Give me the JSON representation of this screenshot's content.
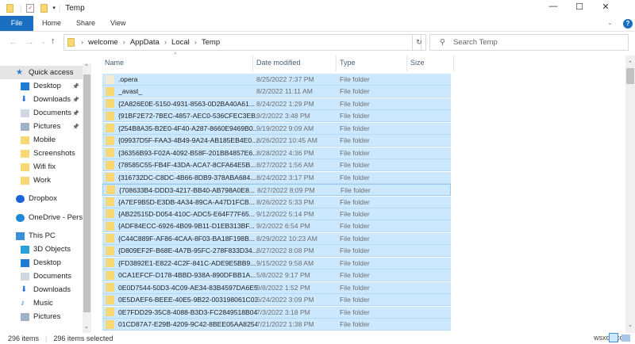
{
  "window": {
    "title": "Temp",
    "minimize": "—",
    "maximize": "☐",
    "close": "✕",
    "help": "?"
  },
  "ribbon": {
    "tabs": [
      "File",
      "Home",
      "Share",
      "View"
    ]
  },
  "address": {
    "crumbs": [
      "welcome",
      "AppData",
      "Local",
      "Temp"
    ],
    "search_placeholder": "Search Temp"
  },
  "nav": {
    "items": [
      {
        "label": "Quick access",
        "icon": "star-icon",
        "color": "#2b78d8",
        "indent": 0,
        "pinned": false
      },
      {
        "label": "Desktop",
        "icon": "desktop-icon",
        "color": "#1e7bd6",
        "indent": 1,
        "pinned": true
      },
      {
        "label": "Downloads",
        "icon": "download-icon",
        "color": "#2b78d8",
        "indent": 1,
        "pinned": true
      },
      {
        "label": "Documents",
        "icon": "document-icon",
        "color": "#cfd8e3",
        "indent": 1,
        "pinned": true
      },
      {
        "label": "Pictures",
        "icon": "pictures-icon",
        "color": "#9fb3c8",
        "indent": 1,
        "pinned": true
      },
      {
        "label": "Mobile",
        "icon": "folder-icon",
        "color": "#f8d775",
        "indent": 1,
        "pinned": false
      },
      {
        "label": "Screenshots",
        "icon": "folder-icon",
        "color": "#f8d775",
        "indent": 1,
        "pinned": false
      },
      {
        "label": "Wifi fix",
        "icon": "folder-icon",
        "color": "#f8d775",
        "indent": 1,
        "pinned": false
      },
      {
        "label": "Work",
        "icon": "folder-icon",
        "color": "#f8d775",
        "indent": 1,
        "pinned": false
      },
      {
        "label": "Dropbox",
        "icon": "dropbox-icon",
        "color": "#1d63d8",
        "indent": 0,
        "pinned": false
      },
      {
        "label": "OneDrive - Person",
        "icon": "onedrive-icon",
        "color": "#1e88d6",
        "indent": 0,
        "pinned": false
      },
      {
        "label": "This PC",
        "icon": "pc-icon",
        "color": "#3b8fd8",
        "indent": 0,
        "pinned": false
      },
      {
        "label": "3D Objects",
        "icon": "3d-objects-icon",
        "color": "#2aa0d8",
        "indent": 1,
        "pinned": false
      },
      {
        "label": "Desktop",
        "icon": "desktop-icon",
        "color": "#1e7bd6",
        "indent": 1,
        "pinned": false
      },
      {
        "label": "Documents",
        "icon": "document-icon",
        "color": "#cfd8e3",
        "indent": 1,
        "pinned": false
      },
      {
        "label": "Downloads",
        "icon": "download-icon",
        "color": "#2b78d8",
        "indent": 1,
        "pinned": false
      },
      {
        "label": "Music",
        "icon": "music-icon",
        "color": "#1e7bd6",
        "indent": 1,
        "pinned": false
      },
      {
        "label": "Pictures",
        "icon": "pictures-icon",
        "color": "#9fb3c8",
        "indent": 1,
        "pinned": false
      }
    ]
  },
  "columns": [
    "Name",
    "Date modified",
    "Type",
    "Size"
  ],
  "files": [
    {
      "name": ".opera",
      "date": "8/25/2022 7:37 PM",
      "type": "File folder"
    },
    {
      "name": "_avast_",
      "date": "8/2/2022 11:11 AM",
      "type": "File folder"
    },
    {
      "name": "{2A826E0E-5150-4931-8563-0D2BA40A61...",
      "date": "8/24/2022 1:29 PM",
      "type": "File folder"
    },
    {
      "name": "{91BF2E72-7BEC-4857-AEC0-536CFEC3EB...",
      "date": "9/2/2022 3:48 PM",
      "type": "File folder"
    },
    {
      "name": "{254B8A35-B2E0-4F40-A287-8660E9469B0...",
      "date": "9/19/2022 9:09 AM",
      "type": "File folder"
    },
    {
      "name": "{09937D5F-FAA3-4B49-9A24-AB185EB4E0...",
      "date": "8/26/2022 10:45 AM",
      "type": "File folder"
    },
    {
      "name": "{36356B93-F02A-4092-B58F-201BB4857E6...",
      "date": "8/28/2022 4:36 PM",
      "type": "File folder"
    },
    {
      "name": "{78585C55-FB4F-43DA-ACA7-8CFA64E5B...",
      "date": "8/27/2022 1:56 AM",
      "type": "File folder"
    },
    {
      "name": "{316732DC-C8DC-4B66-8DB9-378ABA684...",
      "date": "8/24/2022 3:17 PM",
      "type": "File folder"
    },
    {
      "name": "{708633B4-DDD3-4217-BB40-AB798A0E8...",
      "date": "8/27/2022 8:09 PM",
      "type": "File folder"
    },
    {
      "name": "{A7EF9B5D-E3DB-4A34-89CA-A47D1FCB...",
      "date": "8/26/2022 5:33 PM",
      "type": "File folder"
    },
    {
      "name": "{AB22515D-D054-410C-ADC5-E64F77F65...",
      "date": "9/12/2022 5:14 PM",
      "type": "File folder"
    },
    {
      "name": "{ADF84ECC-6926-4B09-9B11-D1EB313BF...",
      "date": "9/2/2022 6:54 PM",
      "type": "File folder"
    },
    {
      "name": "{C44C889F-AF86-4CAA-8F03-BA18F198B...",
      "date": "8/29/2022 10:23 AM",
      "type": "File folder"
    },
    {
      "name": "{D809EF2F-B68E-4A7B-95FC-278F833D34...",
      "date": "8/27/2022 8:08 PM",
      "type": "File folder"
    },
    {
      "name": "{FD3892E1-E822-4C2F-841C-ADE9E5BB9...",
      "date": "9/15/2022 9:58 AM",
      "type": "File folder"
    },
    {
      "name": "0CA1EFCF-D178-4BBD-938A-890DFBB1A...",
      "date": "5/8/2022 9:17 PM",
      "type": "File folder"
    },
    {
      "name": "0E0D7544-50D3-4C09-AE34-83B4597DA6E5",
      "date": "9/8/2022 1:52 PM",
      "type": "File folder"
    },
    {
      "name": "0E5DAEF6-BEEE-40E5-9B22-003198061C03",
      "date": "6/24/2022 3:09 PM",
      "type": "File folder"
    },
    {
      "name": "0E7FDD29-35C8-4088-B3D3-FC2849518B04",
      "date": "7/3/2022 3:18 PM",
      "type": "File folder"
    },
    {
      "name": "01CD87A7-E29B-4209-9C42-8BEE05AA8254",
      "date": "7/21/2022 1:38 PM",
      "type": "File folder"
    }
  ],
  "status": {
    "items": "296 items",
    "selected": "296 items selected"
  },
  "watermark": "wsxdn.com"
}
